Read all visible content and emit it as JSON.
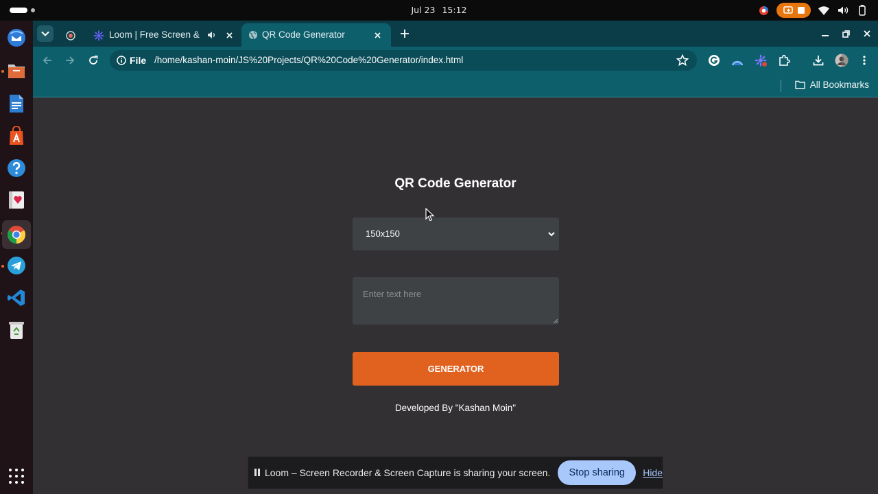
{
  "system": {
    "date": "Jul 23",
    "time": "15:12"
  },
  "dock": {
    "apps": [
      {
        "name": "thunderbird-icon",
        "color": "#2f7bd9"
      },
      {
        "name": "files-icon",
        "color": "#e06c3c"
      },
      {
        "name": "writer-icon",
        "color": "#2e7dd1"
      },
      {
        "name": "app-center-icon",
        "color": "#e95420"
      },
      {
        "name": "help-icon",
        "color": "#2e8bda"
      },
      {
        "name": "solitaire-icon",
        "color": "#d9d9d9"
      },
      {
        "name": "chrome-icon",
        "color": "#dd4b39"
      },
      {
        "name": "telegram-icon",
        "color": "#2aa0da"
      },
      {
        "name": "vscode-icon",
        "color": "#2389d6"
      },
      {
        "name": "trash-icon",
        "color": "#8ec27c"
      }
    ]
  },
  "tabs": [
    {
      "title": "Loom | Free Screen & ",
      "active": false
    },
    {
      "title": "QR Code Generator",
      "active": true
    }
  ],
  "toolbar": {
    "site_label": "File",
    "url": "/home/kashan-moin/JS%20Projects/QR%20Code%20Generator/index.html"
  },
  "bookmarks": {
    "all_label": "All Bookmarks"
  },
  "page": {
    "title": "QR Code Generator",
    "size_value": "150x150",
    "text_placeholder": "Enter text here",
    "button_label": "GENERATOR",
    "credit": "Developed By \"Kashan Moin\""
  },
  "share_bar": {
    "message": "Loom – Screen Recorder & Screen Capture is sharing your screen.",
    "stop_label": "Stop sharing",
    "hide_label": "Hide"
  },
  "colors": {
    "accent": "#e1611e",
    "chrome_toolbar": "#0e5f6c",
    "page_bg": "#333034",
    "stop_button": "#a8c7fa"
  }
}
